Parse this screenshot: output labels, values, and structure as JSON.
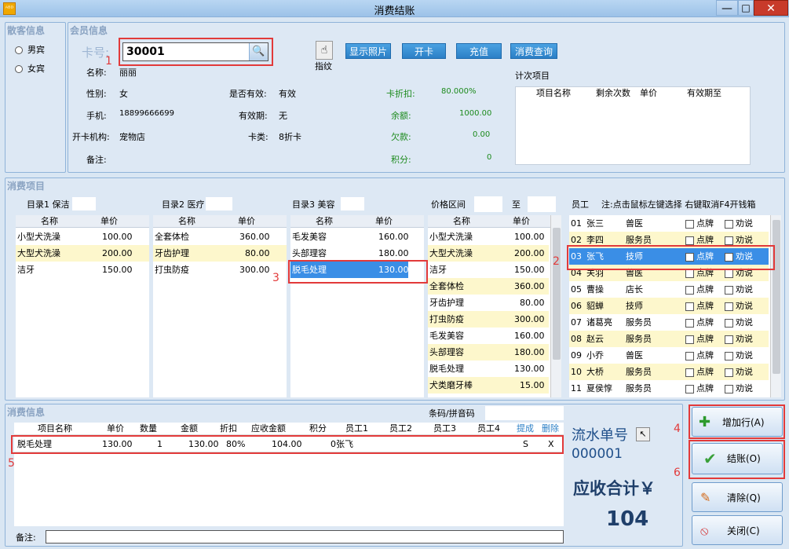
{
  "window": {
    "title": "消费结账",
    "app_icon_text": "ᴬᴮᴰ"
  },
  "guest": {
    "group_title": "散客信息",
    "options": [
      "男宾",
      "女宾"
    ]
  },
  "member": {
    "group_title": "会员信息",
    "card_label": "卡号:",
    "card_value": "30001",
    "fingerprint_label": "指纹",
    "buttons": [
      "显示照片",
      "开卡",
      "充值",
      "消费查询"
    ],
    "name_label": "名称:",
    "name": "丽丽",
    "gender_label": "性别:",
    "gender": "女",
    "phone_label": "手机:",
    "phone": "18899666699",
    "org_label": "开卡机构:",
    "org": "宠物店",
    "note_label": "备注:",
    "valid_label": "是否有效:",
    "valid": "有效",
    "expiry_label": "有效期:",
    "expiry": "无",
    "cardtype_label": "卡类:",
    "cardtype": "8折卡",
    "discount_label": "卡折扣:",
    "discount": "80.000%",
    "balance_label": "余额:",
    "balance": "1000.00",
    "debt_label": "欠款:",
    "debt": "0.00",
    "points_label": "积分:",
    "points": "0",
    "count_items_label": "计次项目",
    "count_headers": [
      "项目名称",
      "剩余次数",
      "单价",
      "有效期至"
    ]
  },
  "consume_items": {
    "group_title": "消费项目",
    "cat1": {
      "label": "目录1 保洁",
      "headers": [
        "名称",
        "单价"
      ],
      "rows": [
        [
          "小型犬洗澡",
          "100.00"
        ],
        [
          "大型犬洗澡",
          "200.00"
        ],
        [
          "洁牙",
          "150.00"
        ]
      ]
    },
    "cat2": {
      "label": "目录2 医疗",
      "headers": [
        "名称",
        "单价"
      ],
      "rows": [
        [
          "全套体检",
          "360.00"
        ],
        [
          "牙齿护理",
          "80.00"
        ],
        [
          "打虫防疫",
          "300.00"
        ]
      ]
    },
    "cat3": {
      "label": "目录3 美容",
      "headers": [
        "名称",
        "单价"
      ],
      "rows": [
        [
          "毛发美容",
          "160.00"
        ],
        [
          "头部理容",
          "180.00"
        ],
        [
          "脱毛处理",
          "130.00"
        ]
      ]
    },
    "price_range": {
      "label": "价格区间",
      "to": "至",
      "headers": [
        "名称",
        "单价"
      ],
      "rows": [
        [
          "小型犬洗澡",
          "100.00"
        ],
        [
          "大型犬洗澡",
          "200.00"
        ],
        [
          "洁牙",
          "150.00"
        ],
        [
          "全套体检",
          "360.00"
        ],
        [
          "牙齿护理",
          "80.00"
        ],
        [
          "打虫防疫",
          "300.00"
        ],
        [
          "毛发美容",
          "160.00"
        ],
        [
          "头部理容",
          "180.00"
        ],
        [
          "脱毛处理",
          "130.00"
        ],
        [
          "犬类磨牙棒",
          "15.00"
        ]
      ]
    },
    "staff": {
      "label": "员工",
      "note": "注:点击鼠标左键选择 右键取消F4开钱箱",
      "point_label": "点牌",
      "persuade_label": "劝说",
      "rows": [
        [
          "01",
          "张三",
          "兽医"
        ],
        [
          "02",
          "李四",
          "服务员"
        ],
        [
          "03",
          "张飞",
          "技师"
        ],
        [
          "04",
          "关羽",
          "兽医"
        ],
        [
          "05",
          "曹操",
          "店长"
        ],
        [
          "06",
          "貂蝉",
          "技师"
        ],
        [
          "07",
          "诸葛亮",
          "服务员"
        ],
        [
          "08",
          "赵云",
          "服务员"
        ],
        [
          "09",
          "小乔",
          "兽医"
        ],
        [
          "10",
          "大桥",
          "服务员"
        ],
        [
          "11",
          "夏侯惇",
          "服务员"
        ]
      ]
    }
  },
  "consume_info": {
    "group_title": "消费信息",
    "barcode_label": "条码/拼音码",
    "headers": [
      "项目名称",
      "单价",
      "数量",
      "金额",
      "折扣",
      "应收金额",
      "积分",
      "员工1",
      "员工2",
      "员工3",
      "员工4",
      "提成",
      "删除"
    ],
    "rows": [
      [
        "脱毛处理",
        "130.00",
        "1",
        "130.00",
        "80%",
        "104.00",
        "0",
        "张飞",
        "",
        "",
        "",
        "S",
        "X"
      ]
    ],
    "note_label": "备注:"
  },
  "summary": {
    "serial_label": "流水单号",
    "serial": "000001",
    "total_label": "应收合计￥",
    "total": "104"
  },
  "actions": {
    "add_row": "增加行(A)",
    "checkout": "结账(O)",
    "clear": "清除(Q)",
    "close": "关闭(C)"
  },
  "annotations": [
    "1",
    "2",
    "3",
    "4",
    "5",
    "6"
  ],
  "colors": {
    "accent": "#2b7fc6",
    "highlight": "#e23a3a",
    "selected": "#3a8ee6",
    "alt_row": "#fdf7cc"
  }
}
